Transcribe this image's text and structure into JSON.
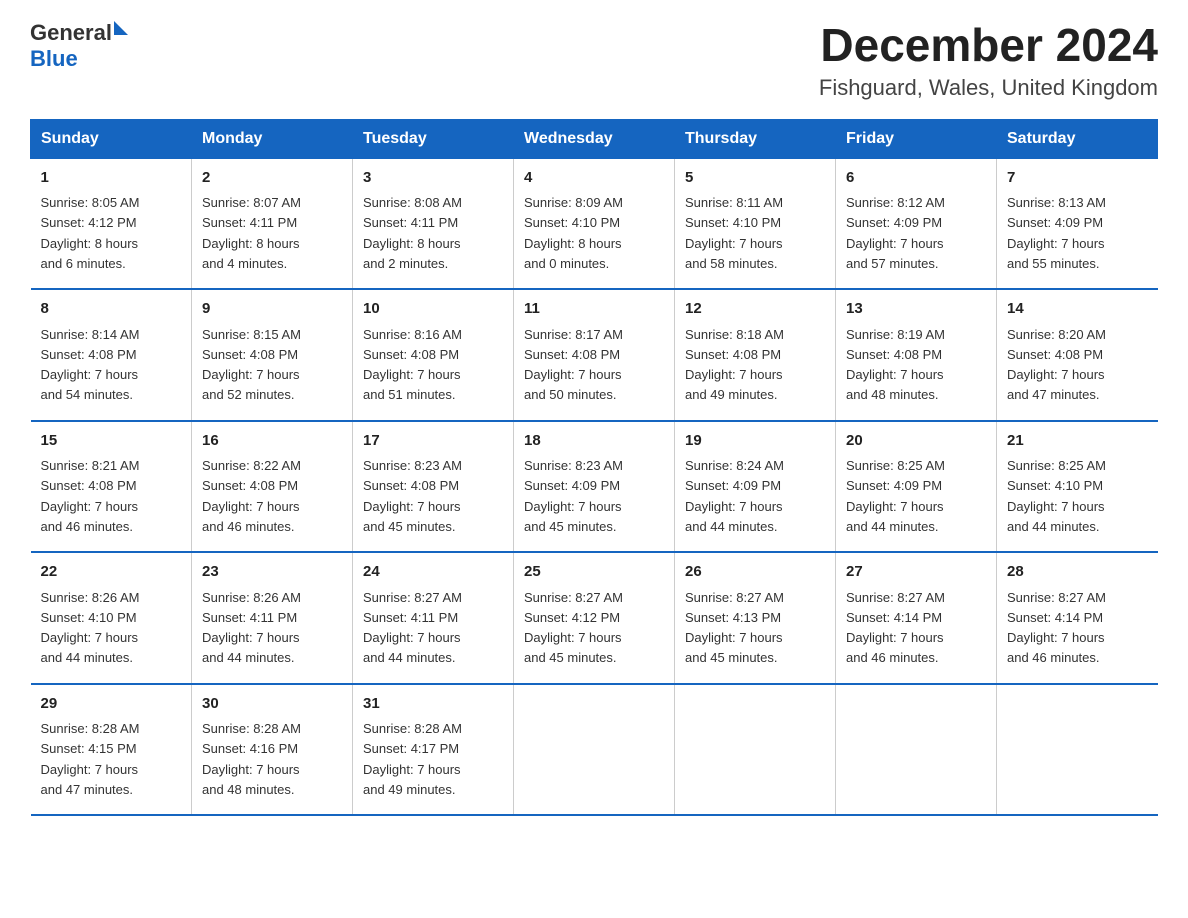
{
  "header": {
    "logo_general": "General",
    "logo_blue": "Blue",
    "month_title": "December 2024",
    "location": "Fishguard, Wales, United Kingdom"
  },
  "columns": [
    "Sunday",
    "Monday",
    "Tuesday",
    "Wednesday",
    "Thursday",
    "Friday",
    "Saturday"
  ],
  "weeks": [
    [
      {
        "day": "1",
        "info": "Sunrise: 8:05 AM\nSunset: 4:12 PM\nDaylight: 8 hours\nand 6 minutes."
      },
      {
        "day": "2",
        "info": "Sunrise: 8:07 AM\nSunset: 4:11 PM\nDaylight: 8 hours\nand 4 minutes."
      },
      {
        "day": "3",
        "info": "Sunrise: 8:08 AM\nSunset: 4:11 PM\nDaylight: 8 hours\nand 2 minutes."
      },
      {
        "day": "4",
        "info": "Sunrise: 8:09 AM\nSunset: 4:10 PM\nDaylight: 8 hours\nand 0 minutes."
      },
      {
        "day": "5",
        "info": "Sunrise: 8:11 AM\nSunset: 4:10 PM\nDaylight: 7 hours\nand 58 minutes."
      },
      {
        "day": "6",
        "info": "Sunrise: 8:12 AM\nSunset: 4:09 PM\nDaylight: 7 hours\nand 57 minutes."
      },
      {
        "day": "7",
        "info": "Sunrise: 8:13 AM\nSunset: 4:09 PM\nDaylight: 7 hours\nand 55 minutes."
      }
    ],
    [
      {
        "day": "8",
        "info": "Sunrise: 8:14 AM\nSunset: 4:08 PM\nDaylight: 7 hours\nand 54 minutes."
      },
      {
        "day": "9",
        "info": "Sunrise: 8:15 AM\nSunset: 4:08 PM\nDaylight: 7 hours\nand 52 minutes."
      },
      {
        "day": "10",
        "info": "Sunrise: 8:16 AM\nSunset: 4:08 PM\nDaylight: 7 hours\nand 51 minutes."
      },
      {
        "day": "11",
        "info": "Sunrise: 8:17 AM\nSunset: 4:08 PM\nDaylight: 7 hours\nand 50 minutes."
      },
      {
        "day": "12",
        "info": "Sunrise: 8:18 AM\nSunset: 4:08 PM\nDaylight: 7 hours\nand 49 minutes."
      },
      {
        "day": "13",
        "info": "Sunrise: 8:19 AM\nSunset: 4:08 PM\nDaylight: 7 hours\nand 48 minutes."
      },
      {
        "day": "14",
        "info": "Sunrise: 8:20 AM\nSunset: 4:08 PM\nDaylight: 7 hours\nand 47 minutes."
      }
    ],
    [
      {
        "day": "15",
        "info": "Sunrise: 8:21 AM\nSunset: 4:08 PM\nDaylight: 7 hours\nand 46 minutes."
      },
      {
        "day": "16",
        "info": "Sunrise: 8:22 AM\nSunset: 4:08 PM\nDaylight: 7 hours\nand 46 minutes."
      },
      {
        "day": "17",
        "info": "Sunrise: 8:23 AM\nSunset: 4:08 PM\nDaylight: 7 hours\nand 45 minutes."
      },
      {
        "day": "18",
        "info": "Sunrise: 8:23 AM\nSunset: 4:09 PM\nDaylight: 7 hours\nand 45 minutes."
      },
      {
        "day": "19",
        "info": "Sunrise: 8:24 AM\nSunset: 4:09 PM\nDaylight: 7 hours\nand 44 minutes."
      },
      {
        "day": "20",
        "info": "Sunrise: 8:25 AM\nSunset: 4:09 PM\nDaylight: 7 hours\nand 44 minutes."
      },
      {
        "day": "21",
        "info": "Sunrise: 8:25 AM\nSunset: 4:10 PM\nDaylight: 7 hours\nand 44 minutes."
      }
    ],
    [
      {
        "day": "22",
        "info": "Sunrise: 8:26 AM\nSunset: 4:10 PM\nDaylight: 7 hours\nand 44 minutes."
      },
      {
        "day": "23",
        "info": "Sunrise: 8:26 AM\nSunset: 4:11 PM\nDaylight: 7 hours\nand 44 minutes."
      },
      {
        "day": "24",
        "info": "Sunrise: 8:27 AM\nSunset: 4:11 PM\nDaylight: 7 hours\nand 44 minutes."
      },
      {
        "day": "25",
        "info": "Sunrise: 8:27 AM\nSunset: 4:12 PM\nDaylight: 7 hours\nand 45 minutes."
      },
      {
        "day": "26",
        "info": "Sunrise: 8:27 AM\nSunset: 4:13 PM\nDaylight: 7 hours\nand 45 minutes."
      },
      {
        "day": "27",
        "info": "Sunrise: 8:27 AM\nSunset: 4:14 PM\nDaylight: 7 hours\nand 46 minutes."
      },
      {
        "day": "28",
        "info": "Sunrise: 8:27 AM\nSunset: 4:14 PM\nDaylight: 7 hours\nand 46 minutes."
      }
    ],
    [
      {
        "day": "29",
        "info": "Sunrise: 8:28 AM\nSunset: 4:15 PM\nDaylight: 7 hours\nand 47 minutes."
      },
      {
        "day": "30",
        "info": "Sunrise: 8:28 AM\nSunset: 4:16 PM\nDaylight: 7 hours\nand 48 minutes."
      },
      {
        "day": "31",
        "info": "Sunrise: 8:28 AM\nSunset: 4:17 PM\nDaylight: 7 hours\nand 49 minutes."
      },
      {
        "day": "",
        "info": ""
      },
      {
        "day": "",
        "info": ""
      },
      {
        "day": "",
        "info": ""
      },
      {
        "day": "",
        "info": ""
      }
    ]
  ]
}
